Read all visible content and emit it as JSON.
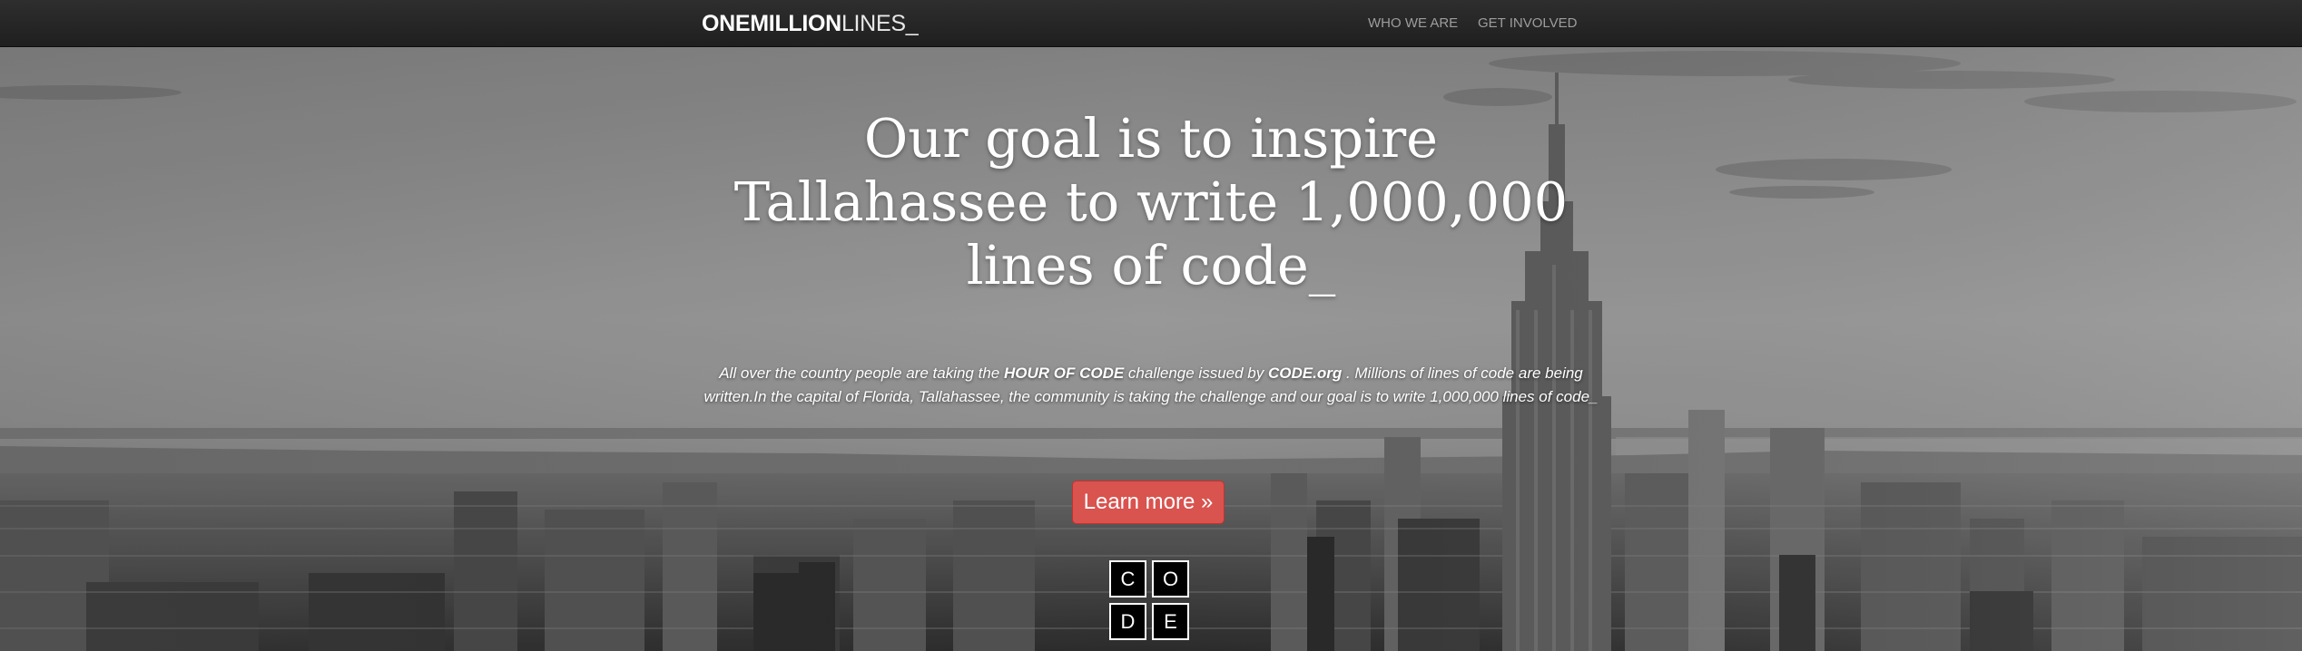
{
  "nav": {
    "brand_bold": "ONEMILLION",
    "brand_thin": "LINES_",
    "links": [
      "WHO WE ARE",
      "GET INVOLVED"
    ]
  },
  "hero": {
    "headline_lines": [
      "Our goal is to inspire",
      "Tallahassee to write 1,000,000",
      "lines of code_"
    ],
    "intro": {
      "part1": "All over the country people are taking the ",
      "hour_of_code": "HOUR OF CODE",
      "part2": " challenge issued by ",
      "code_org": "CODE.org",
      "part3": " . Millions of lines of code are being written.In the capital of Florida, Tallahassee, the community is taking the challenge and our goal is to write 1,000,000 lines of code_"
    },
    "button_label": "Learn more »",
    "code_logo_letters": [
      "C",
      "O",
      "D",
      "E"
    ],
    "background_description_icon": "city-skyline-image"
  },
  "colors": {
    "navbar_bg": "#222222",
    "nav_link": "#9d9d9d",
    "button_bg": "#d9534f",
    "text": "#ffffff"
  }
}
